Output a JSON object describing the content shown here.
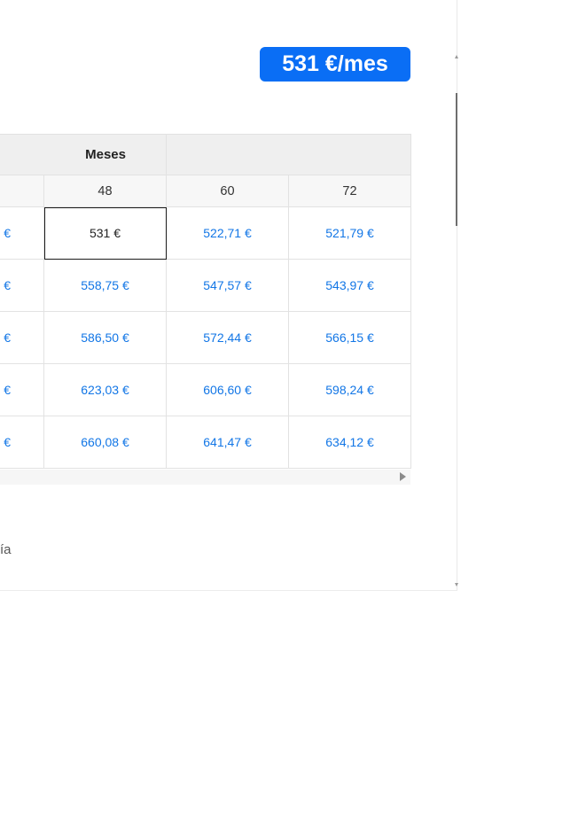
{
  "price_badge": "531 €/mes",
  "table": {
    "header": "Meses",
    "months": [
      "",
      "48",
      "60",
      "72"
    ],
    "rows": [
      [
        "€",
        "531 €",
        "522,71 €",
        "521,79 €"
      ],
      [
        "€",
        "558,75 €",
        "547,57 €",
        "543,97 €"
      ],
      [
        "€",
        "586,50 €",
        "572,44 €",
        "566,15 €"
      ],
      [
        "€",
        "623,03 €",
        "606,60 €",
        "598,24 €"
      ],
      [
        "€",
        "660,08 €",
        "641,47 €",
        "634,12 €"
      ]
    ],
    "selected": {
      "row": 0,
      "col": 1
    }
  },
  "footer_fragment": "ía",
  "colors": {
    "accent": "#0a6ef5",
    "link": "#1276e6"
  }
}
